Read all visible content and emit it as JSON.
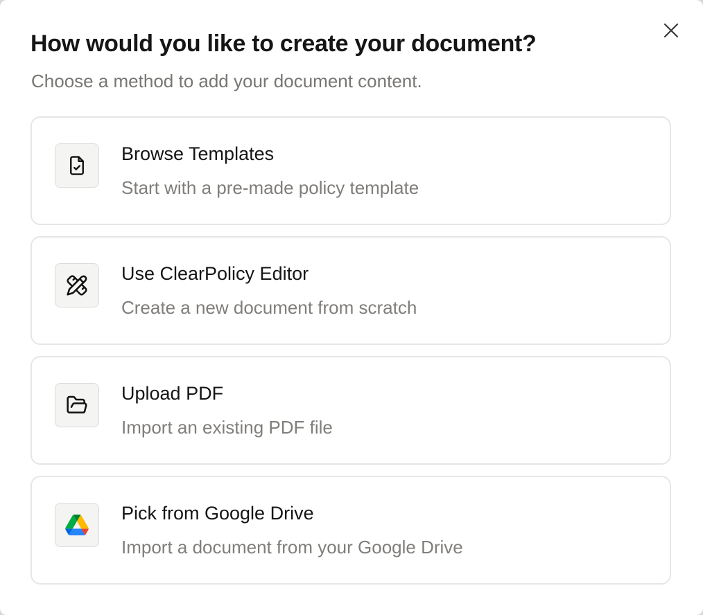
{
  "dialog": {
    "title": "How would you like to create your document?",
    "subtitle": "Choose a method to add your document content.",
    "close_icon": "close-icon"
  },
  "options": [
    {
      "title": "Browse Templates",
      "description": "Start with a pre-made policy template",
      "icon": "file-check-icon"
    },
    {
      "title": "Use ClearPolicy Editor",
      "description": "Create a new document from scratch",
      "icon": "pencil-ruler-icon"
    },
    {
      "title": "Upload PDF",
      "description": "Import an existing PDF file",
      "icon": "folder-open-icon"
    },
    {
      "title": "Pick from Google Drive",
      "description": "Import a document from your Google Drive",
      "icon": "google-drive-icon"
    }
  ],
  "colors": {
    "title_text": "#151515",
    "muted_text": "#787672",
    "card_border": "#e6e6e4",
    "icon_box_bg": "#f4f4f3",
    "drive_green": "#0f9d58",
    "drive_yellow": "#f4b400",
    "drive_blue": "#4285f4"
  }
}
